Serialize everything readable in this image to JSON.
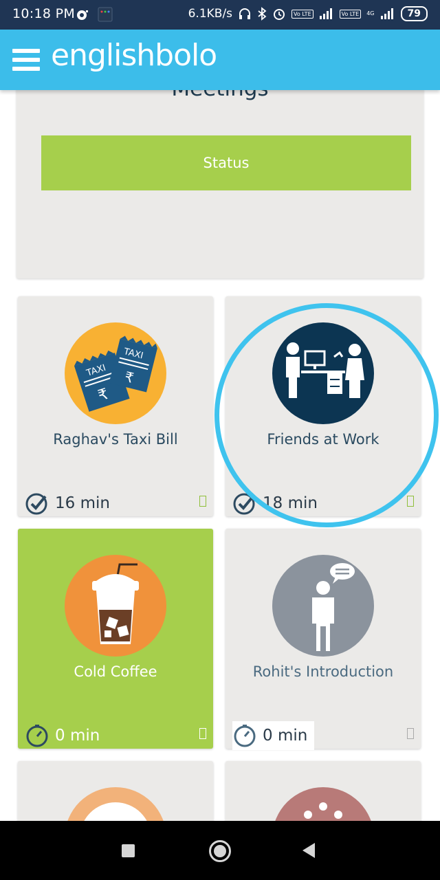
{
  "status_bar": {
    "time": "10:18 PM",
    "network_speed": "6.1KB/s",
    "lte1": "Vo LTE",
    "lte2": "Vo LTE",
    "net_4g": "4G",
    "battery": "79"
  },
  "app_bar": {
    "brand": "englishbolo"
  },
  "top_card": {
    "title": "Meetings",
    "status_button": "Status"
  },
  "lessons": [
    {
      "title": "Raghav's Taxi Bill",
      "time": "16 min",
      "icon": "taxi-receipts-icon",
      "circle_color": "#f8b133",
      "state": "default"
    },
    {
      "title": "Friends at Work",
      "time": "18 min",
      "icon": "office-colleagues-icon",
      "circle_color": "#0c3552",
      "state": "highlighted"
    },
    {
      "title": "Cold Coffee",
      "time": "0 min",
      "icon": "iced-coffee-icon",
      "circle_color": "#f0923b",
      "state": "selected"
    },
    {
      "title": "Rohit's Introduction",
      "time": "0 min",
      "icon": "person-speaking-icon",
      "circle_color": "#8b939d",
      "state": "default"
    },
    {
      "title": "",
      "time": "",
      "icon": "partial-icon",
      "circle_color": "#f2b27a",
      "state": "partial"
    },
    {
      "title": "",
      "time": "",
      "icon": "partial-icon",
      "circle_color": "#b87a78",
      "state": "partial"
    }
  ],
  "colors": {
    "header": "#3cbdea",
    "status_bar": "#1f3554",
    "accent_green": "#a6cf4c",
    "card_bg": "#ebeae8",
    "highlight_ring": "#3fc3ee"
  }
}
